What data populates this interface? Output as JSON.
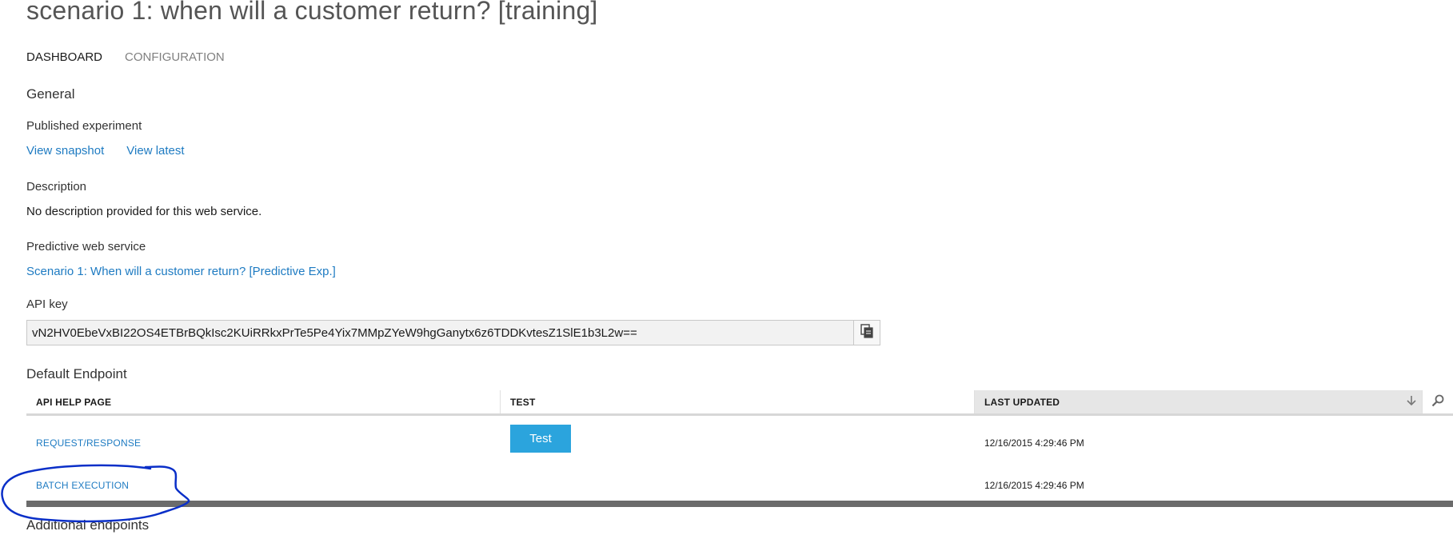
{
  "page": {
    "title": "scenario 1: when will a customer return? [training]"
  },
  "tabs": [
    {
      "label": "DASHBOARD",
      "active": true
    },
    {
      "label": "CONFIGURATION",
      "active": false
    }
  ],
  "general": {
    "heading": "General",
    "published_experiment": {
      "label": "Published experiment",
      "links": [
        "View snapshot",
        "View latest"
      ]
    },
    "description": {
      "label": "Description",
      "value": "No description provided for this web service."
    },
    "predictive_web_service": {
      "label": "Predictive web service",
      "link": "Scenario 1: When will a customer return? [Predictive Exp.]"
    },
    "api_key": {
      "label": "API key",
      "value": "vN2HV0EbeVxBI22OS4ETBrBQkIsc2KUiRRkxPrTe5Pe4Yix7MMpZYeW9hgGanytx6z6TDDKvtesZ1SlE1b3L2w=="
    }
  },
  "default_endpoint": {
    "heading": "Default Endpoint",
    "columns": [
      "API HELP PAGE",
      "TEST",
      "LAST UPDATED"
    ],
    "rows": [
      {
        "api_help_page": "REQUEST/RESPONSE",
        "test_label": "Test",
        "last_updated": "12/16/2015 4:29:46 PM"
      },
      {
        "api_help_page": "BATCH EXECUTION",
        "test_label": "",
        "last_updated": "12/16/2015 4:29:46 PM"
      }
    ]
  },
  "additional_endpoints": {
    "heading": "Additional endpoints"
  },
  "icons": {
    "copy": "copy-icon",
    "sort": "sort-descending-icon",
    "search": "search-icon"
  },
  "colors": {
    "link": "#1e7bc2",
    "test_button": "#2ba4dd",
    "annotation": "#0033cc"
  }
}
